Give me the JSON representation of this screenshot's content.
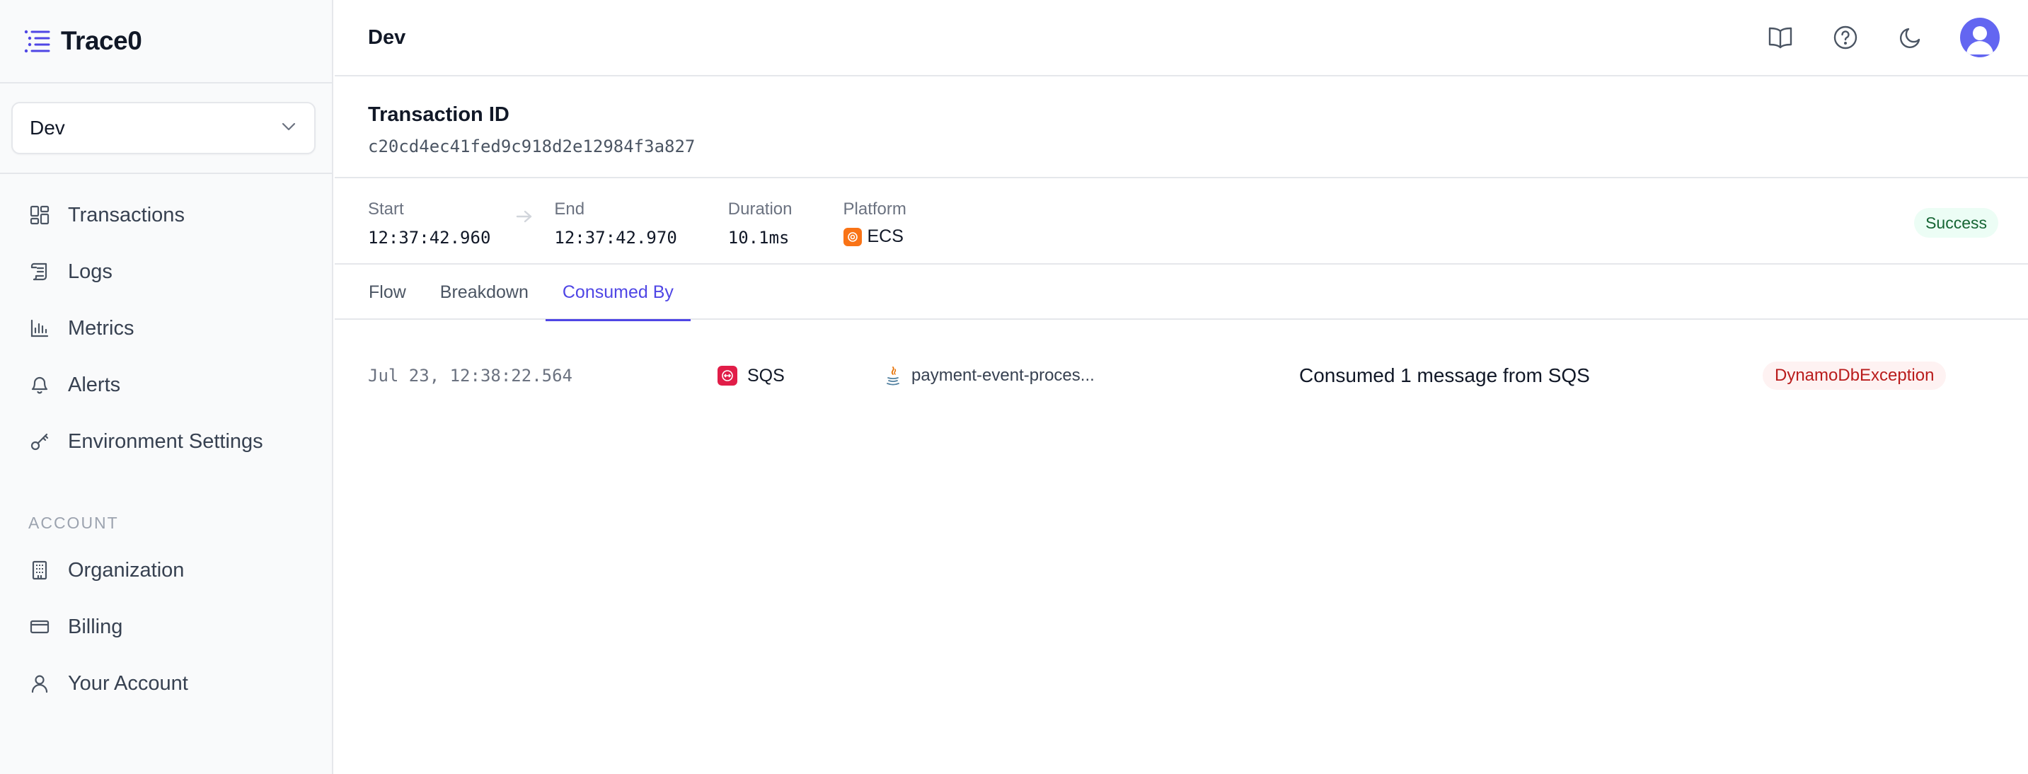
{
  "brand": {
    "name": "Trace0",
    "accent": "#4f46e5"
  },
  "env": {
    "selected": "Dev"
  },
  "nav": {
    "items": [
      {
        "label": "Transactions",
        "icon": "grid-icon"
      },
      {
        "label": "Logs",
        "icon": "scroll-icon"
      },
      {
        "label": "Metrics",
        "icon": "bar-chart-icon"
      },
      {
        "label": "Alerts",
        "icon": "bell-icon"
      },
      {
        "label": "Environment Settings",
        "icon": "key-icon"
      }
    ],
    "account_section": "ACCOUNT",
    "account_items": [
      {
        "label": "Organization",
        "icon": "building-icon"
      },
      {
        "label": "Billing",
        "icon": "credit-card-icon"
      },
      {
        "label": "Your Account",
        "icon": "user-icon"
      }
    ]
  },
  "topbar": {
    "title": "Dev",
    "icons": [
      "book-icon",
      "help-icon",
      "moon-icon",
      "avatar"
    ]
  },
  "transaction": {
    "label": "Transaction ID",
    "id": "c20cd4ec41fed9c918d2e12984f3a827"
  },
  "meta": {
    "start_label": "Start",
    "start_value": "12:37:42.960",
    "end_label": "End",
    "end_value": "12:37:42.970",
    "duration_label": "Duration",
    "duration_value": "10.1ms",
    "platform_label": "Platform",
    "platform_value": "ECS",
    "status": "Success",
    "status_color": "#166534"
  },
  "tabs": [
    {
      "label": "Flow",
      "active": false
    },
    {
      "label": "Breakdown",
      "active": false
    },
    {
      "label": "Consumed By",
      "active": true
    }
  ],
  "consumers": [
    {
      "time": "Jul 23, 12:38:22.564",
      "service": "SQS",
      "function": "payment-event-proces...",
      "message": "Consumed 1 message from SQS",
      "error": "DynamoDbException",
      "error_color": "#b91c1c"
    }
  ]
}
